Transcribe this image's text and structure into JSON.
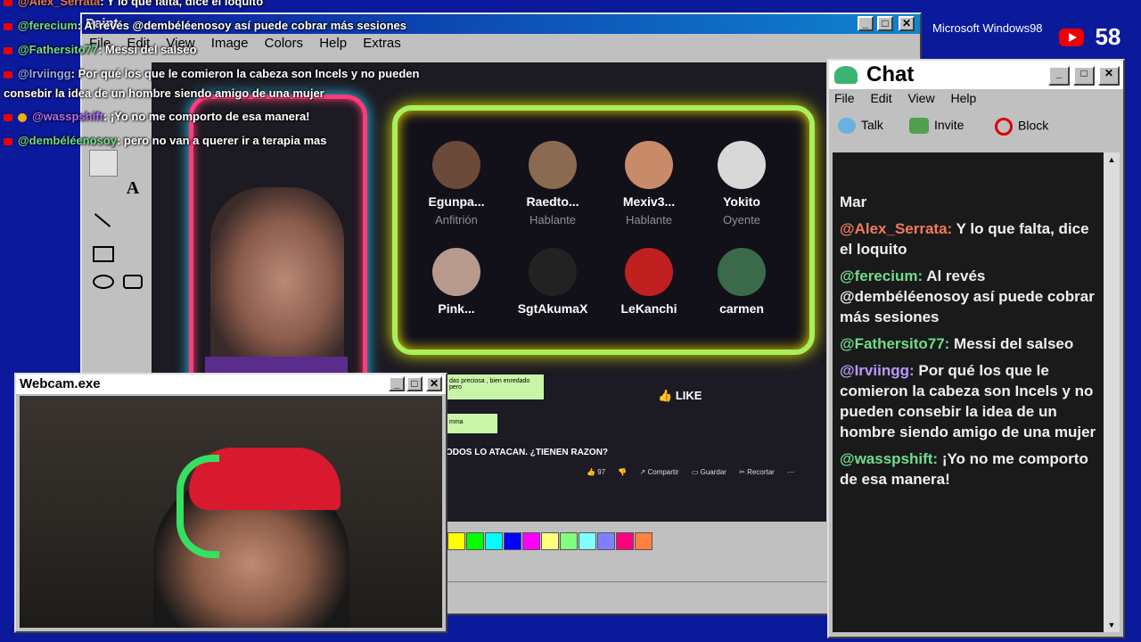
{
  "overlay_chat": [
    {
      "user": "@Alex_Serrata",
      "text": ": Y lo que falta, dice el loquito",
      "color": "#e07b53"
    },
    {
      "user": "@ferecium",
      "text": ": Al revés @dembéléenosoy así puede cobrar más sesiones",
      "color": "#6fdc8c"
    },
    {
      "user": "@Fathersito77",
      "text": ": Messi del salseo",
      "color": "#6fdc8c"
    },
    {
      "user": "@Irviingg",
      "text": ": Por qué los que le comieron la cabeza son Incels y no pueden",
      "color": "#9aa7ff"
    },
    {
      "user": "",
      "text": "consebir la idea de un hombre siendo amigo de una mujer",
      "color": "#ffffff"
    },
    {
      "user": "@wasspshift",
      "text": ": ¡Yo no me comporto de esa manera!",
      "color": "#b06cff"
    },
    {
      "user": "@dembéléenosoy",
      "text": ": pero no van a querer ir a terapia mas",
      "color": "#6fdc8c"
    }
  ],
  "paint": {
    "title": "Paint",
    "menu": [
      "File",
      "Edit",
      "View",
      "Image",
      "Colors",
      "Help",
      "Extras"
    ],
    "palette": [
      "#ffff00",
      "#00ff00",
      "#00ffff",
      "#0000ff",
      "#ff00ff",
      "#ffff80",
      "#80ff80",
      "#80ffff",
      "#8080ff",
      "#ff0080",
      "#ff8040"
    ]
  },
  "spaces": {
    "participants": [
      {
        "name": "Egunpa...",
        "role": "Anfitrión",
        "avatar": "#6b4a3a"
      },
      {
        "name": "Raedto...",
        "role": "Hablante",
        "avatar": "#8a6a50"
      },
      {
        "name": "Mexiv3...",
        "role": "Hablante",
        "avatar": "#c98a6a"
      },
      {
        "name": "Yokito",
        "role": "Oyente",
        "avatar": "#d8d8d8"
      },
      {
        "name": "Pink...",
        "role": "",
        "avatar": "#b89a8c"
      },
      {
        "name": "SgtAkumaX",
        "role": "",
        "avatar": "#222222"
      },
      {
        "name": "LeKanchi",
        "role": "",
        "avatar": "#c02020"
      },
      {
        "name": "carmen",
        "role": "",
        "avatar": "#3a6a4a"
      }
    ],
    "like_label": "LIKE"
  },
  "video_info": {
    "title": "ODOS LO ATACAN. ¿TIENEN RAZON?",
    "likes": "97",
    "share": "Compartir",
    "save": "Guardar",
    "clip": "Recortar",
    "bubble1": "das preciosa , bien enredado pero",
    "bubble2": "mma"
  },
  "webcam": {
    "title": "Webcam.exe"
  },
  "taskbar": {
    "logo": "Microsoft Windows98",
    "viewer_count": "58"
  },
  "chat": {
    "title": "Chat",
    "menu": [
      "File",
      "Edit",
      "View",
      "Help"
    ],
    "toolbar": [
      "Talk",
      "Invite",
      "Block"
    ],
    "messages": [
      {
        "user": "",
        "text": "Mar",
        "color": "#ffffff"
      },
      {
        "user": "@Alex_Serrata:",
        "text": " Y lo que falta, dice el loquito",
        "color": "#f07b5a"
      },
      {
        "user": "@ferecium:",
        "text": " Al revés @dembéléenosoy así puede cobrar más sesiones",
        "color": "#6fdc8c"
      },
      {
        "user": "@Fathersito77:",
        "text": " Messi del salseo",
        "color": "#6fdc8c"
      },
      {
        "user": "@Irviingg:",
        "text": " Por qué los que le comieron la cabeza son Incels y no pueden consebir la idea de un hombre siendo amigo de una mujer",
        "color": "#b79cff"
      },
      {
        "user": "@wasspshift:",
        "text": " ¡Yo no me comporto de esa manera!",
        "color": "#6fdc8c"
      }
    ]
  }
}
